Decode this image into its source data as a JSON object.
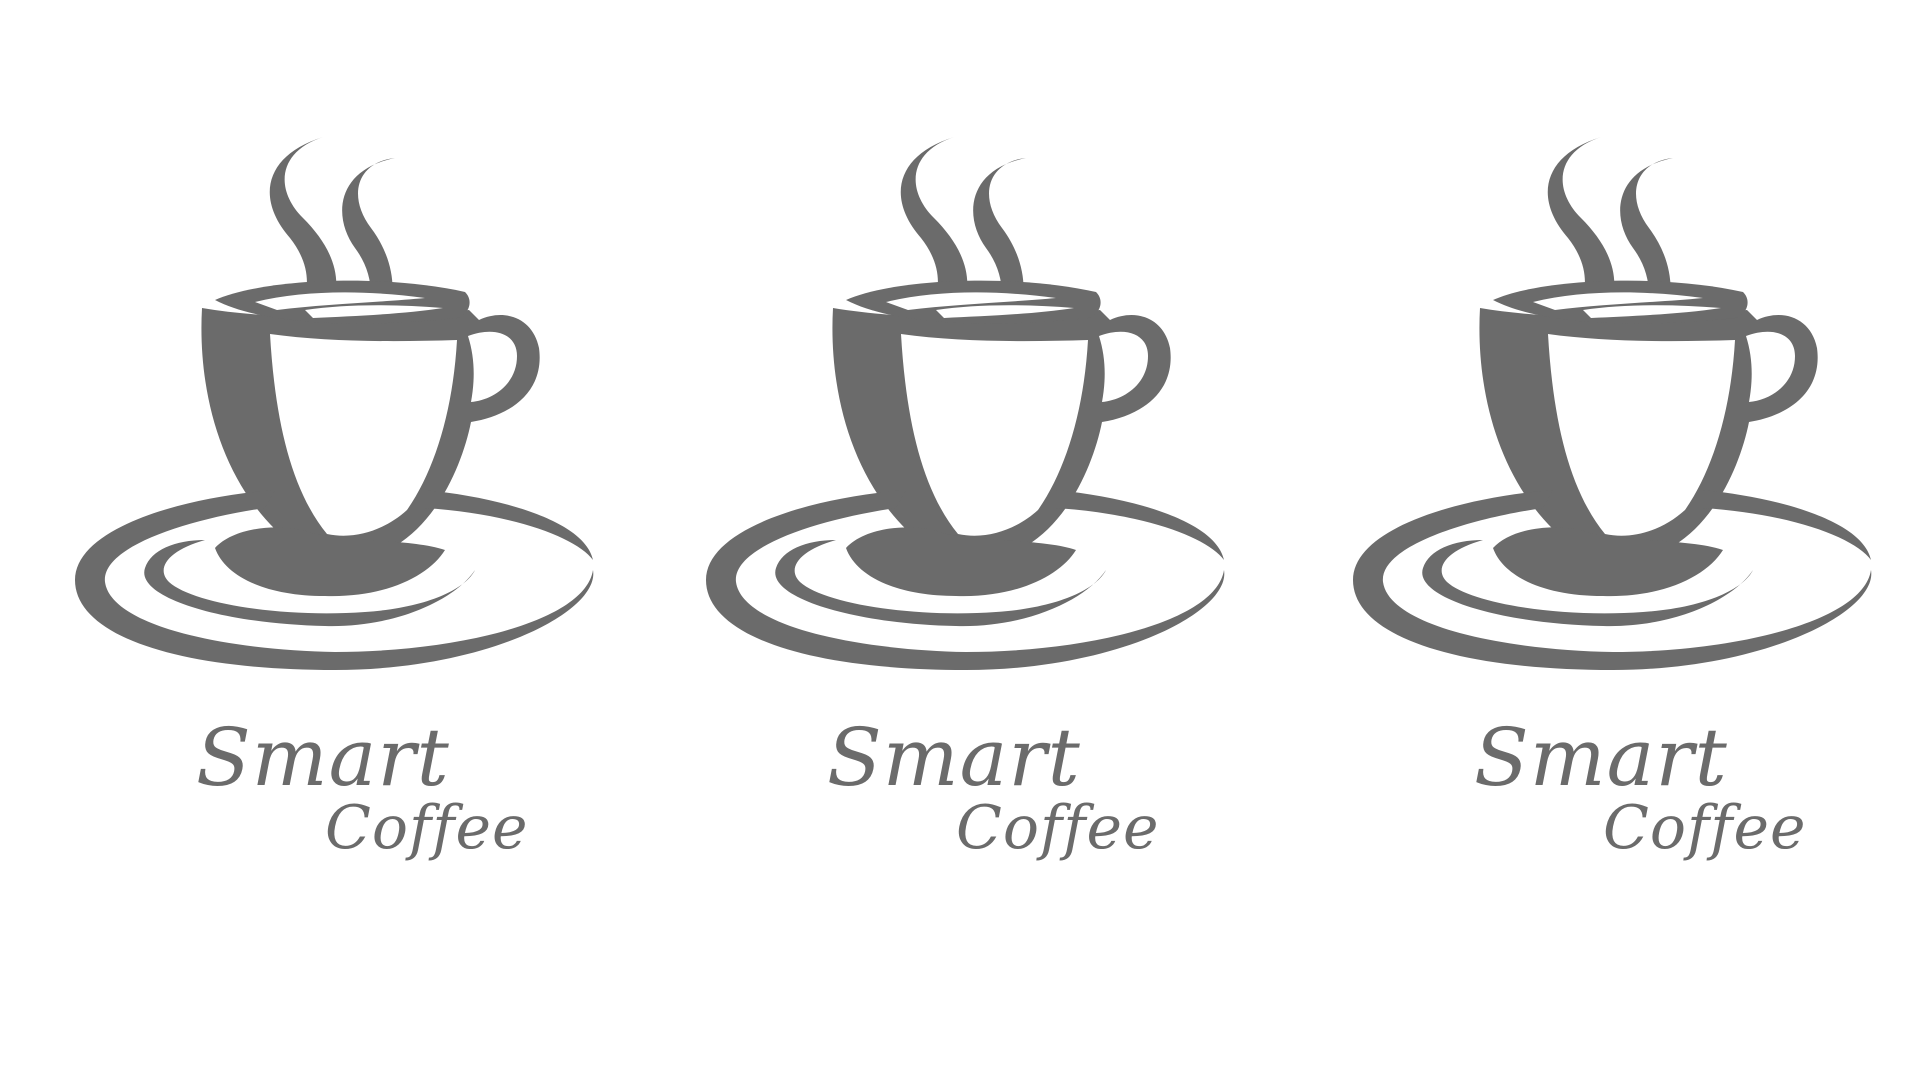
{
  "logos": [
    {
      "line1": "Smart",
      "line2": "Coffee"
    },
    {
      "line1": "Smart",
      "line2": "Coffee"
    },
    {
      "line1": "Smart",
      "line2": "Coffee"
    }
  ],
  "colors": {
    "ink": "#6b6b6b",
    "background": "#ffffff"
  },
  "icons": {
    "logo_mark": "coffee-cup-icon"
  }
}
